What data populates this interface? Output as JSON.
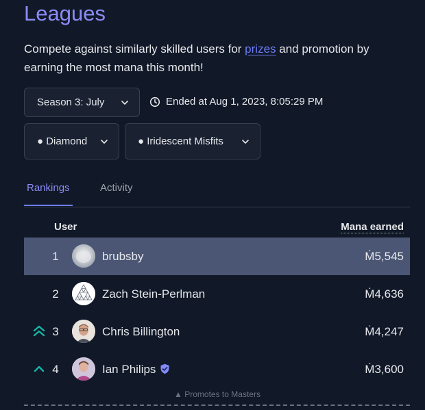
{
  "page": {
    "title": "Leagues",
    "description_before": "Compete against similarly skilled users for ",
    "description_link": "prizes",
    "description_after": " and promotion by earning the most mana this month!"
  },
  "filters": {
    "season": "Season 3: July",
    "ended_text": "Ended at Aug 1, 2023, 8:05:29 PM",
    "tier": "● Diamond",
    "cohort": "● Iridescent Misfits"
  },
  "tabs": [
    {
      "label": "Rankings",
      "active": true
    },
    {
      "label": "Activity",
      "active": false
    }
  ],
  "table": {
    "col_user": "User",
    "col_mana": "Mana earned",
    "rows": [
      {
        "rank": "1",
        "name": "brubsby",
        "mana": "Ṁ5,545",
        "highlight": true,
        "promo": "none",
        "verified": false
      },
      {
        "rank": "2",
        "name": "Zach Stein-Perlman",
        "mana": "Ṁ4,636",
        "highlight": false,
        "promo": "none",
        "verified": false
      },
      {
        "rank": "3",
        "name": "Chris Billington",
        "mana": "Ṁ4,247",
        "highlight": false,
        "promo": "double-chevron-up",
        "verified": false
      },
      {
        "rank": "4",
        "name": "Ian Philips",
        "mana": "Ṁ3,600",
        "highlight": false,
        "promo": "chevron-up",
        "verified": true
      }
    ]
  },
  "footer_note": "▲ Promotes to Masters",
  "colors": {
    "accent": "#8b8cf6",
    "link": "#6d7cf7",
    "promo_green": "#14b8a6",
    "highlight_row": "#4b5675",
    "background": "#111827"
  }
}
